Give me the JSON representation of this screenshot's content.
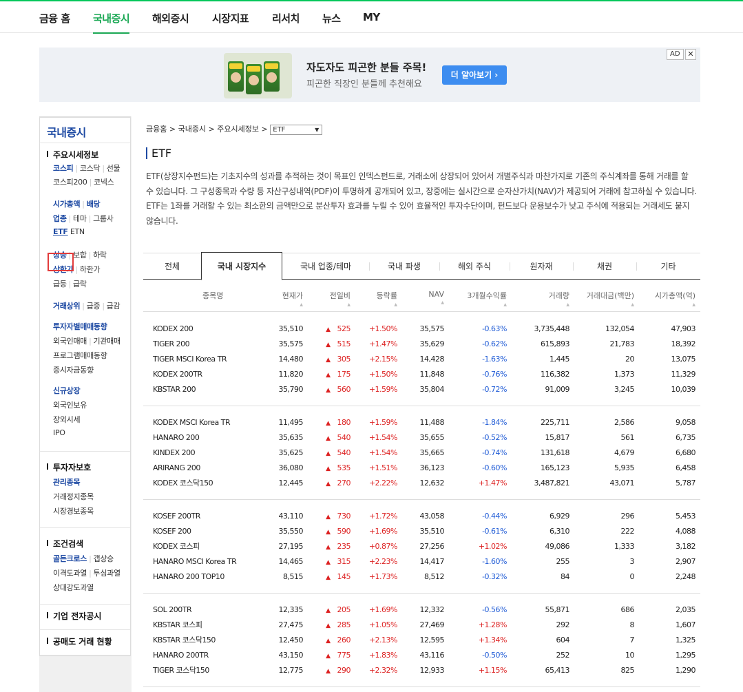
{
  "gnb": {
    "items": [
      "금융 홈",
      "국내증시",
      "해외증시",
      "시장지표",
      "리서치",
      "뉴스",
      "MY"
    ],
    "active_index": 1
  },
  "ad": {
    "title": "자도자도 피곤한 분들 주목!",
    "subtitle": "피곤한 직장인 분들께 추천해요",
    "button": "더 알아보기 ›",
    "mark": "AD",
    "close": "✕"
  },
  "lnb": {
    "title": "국내증시",
    "sections": [
      {
        "heading": "주요시세정보",
        "rows": [
          [
            {
              "t": "코스피",
              "b": true
            },
            {
              "t": "코스닥"
            },
            {
              "t": "선물"
            }
          ],
          [
            {
              "t": "코스피200"
            },
            {
              "t": "코넥스"
            }
          ],
          [
            {
              "t": "시가총액",
              "b": true
            },
            {
              "t": "배당",
              "b": true
            }
          ],
          [
            {
              "t": "업종",
              "b": true
            },
            {
              "t": "테마"
            },
            {
              "t": "그룹사"
            }
          ],
          [
            {
              "t": "ETF",
              "b": true,
              "u": true
            },
            {
              "t": "ETN",
              "nosep": true
            }
          ],
          [
            {
              "t": "상승",
              "b": true
            },
            {
              "t": "보합"
            },
            {
              "t": "하락"
            }
          ],
          [
            {
              "t": "상한가",
              "b": true
            },
            {
              "t": "하한가"
            }
          ],
          [
            {
              "t": "급등"
            },
            {
              "t": "급락"
            }
          ],
          [
            {
              "t": "거래상위",
              "b": true
            },
            {
              "t": "급증"
            },
            {
              "t": "급감"
            }
          ],
          [
            {
              "t": "투자자별매매동향",
              "b": true
            }
          ],
          [
            {
              "t": "외국인매매"
            },
            {
              "t": "기관매매"
            }
          ],
          [
            {
              "t": "프로그램매매동향"
            }
          ],
          [
            {
              "t": "증시자금동향"
            }
          ],
          [
            {
              "t": "신규상장",
              "b": true
            }
          ],
          [
            {
              "t": "외국인보유"
            }
          ],
          [
            {
              "t": "장외시세"
            }
          ],
          [
            {
              "t": "IPO"
            }
          ]
        ]
      },
      {
        "heading": "투자자보호",
        "rows": [
          [
            {
              "t": "관리종목",
              "b": true
            }
          ],
          [
            {
              "t": "거래정지종목"
            }
          ],
          [
            {
              "t": "시장경보종목"
            }
          ]
        ]
      },
      {
        "heading": "조건검색",
        "rows": [
          [
            {
              "t": "골든크로스",
              "b": true
            },
            {
              "t": "갭상승"
            }
          ],
          [
            {
              "t": "이격도과열"
            },
            {
              "t": "투심과열"
            }
          ],
          [
            {
              "t": "상대강도과열"
            }
          ]
        ]
      },
      {
        "heading": "기업 전자공시",
        "rows": []
      },
      {
        "heading": "공매도 거래 현황",
        "rows": []
      }
    ]
  },
  "breadcrumb": {
    "items": [
      "금융홈",
      "국내증시",
      "주요시세정보"
    ],
    "separator": ">",
    "select_value": "ETF"
  },
  "page": {
    "title": "ETF",
    "description": "ETF(상장지수펀드)는 기초지수의 성과를 추적하는 것이 목표인 인덱스펀드로, 거래소에 상장되어 있어서 개별주식과 마찬가지로 기존의 주식계좌를 통해 거래를 할 수 있습니다. 그 구성종목과 수량 등 자산구성내역(PDF)이 투명하게 공개되어 있고, 장중에는 실시간으로 순자산가치(NAV)가 제공되어 거래에 참고하실 수 있습니다. ETF는 1좌를 거래할 수 있는 최소한의 금액만으로 분산투자 효과를 누릴 수 있어 효율적인 투자수단이며, 펀드보다 운용보수가 낮고 주식에 적용되는 거래세도 붙지 않습니다."
  },
  "tabs": {
    "items": [
      "전체",
      "국내 시장지수",
      "국내 업종/테마",
      "국내 파생",
      "해외 주식",
      "원자재",
      "채권",
      "기타"
    ],
    "active_index": 1
  },
  "table": {
    "headers": [
      "종목명",
      "현재가",
      "전일비",
      "등락률",
      "NAV",
      "3개월수익률",
      "거래량",
      "거래대금(백만)",
      "시가총액(억)"
    ],
    "sort_glyph": "▲",
    "up_glyph": "▲",
    "groups": [
      [
        [
          "KODEX 200",
          "35,510",
          "525",
          "+1.50%",
          "35,575",
          "-0.63%",
          "3,735,448",
          "132,054",
          "47,903"
        ],
        [
          "TIGER 200",
          "35,575",
          "515",
          "+1.47%",
          "35,629",
          "-0.62%",
          "615,893",
          "21,783",
          "18,392"
        ],
        [
          "TIGER MSCI Korea TR",
          "14,480",
          "305",
          "+2.15%",
          "14,428",
          "-1.63%",
          "1,445",
          "20",
          "13,075"
        ],
        [
          "KODEX 200TR",
          "11,820",
          "175",
          "+1.50%",
          "11,848",
          "-0.76%",
          "116,382",
          "1,373",
          "11,329"
        ],
        [
          "KBSTAR 200",
          "35,790",
          "560",
          "+1.59%",
          "35,804",
          "-0.72%",
          "91,009",
          "3,245",
          "10,039"
        ]
      ],
      [
        [
          "KODEX MSCI Korea TR",
          "11,495",
          "180",
          "+1.59%",
          "11,488",
          "-1.84%",
          "225,711",
          "2,586",
          "9,058"
        ],
        [
          "HANARO 200",
          "35,635",
          "540",
          "+1.54%",
          "35,655",
          "-0.52%",
          "15,817",
          "561",
          "6,735"
        ],
        [
          "KINDEX 200",
          "35,625",
          "540",
          "+1.54%",
          "35,665",
          "-0.74%",
          "131,618",
          "4,679",
          "6,680"
        ],
        [
          "ARIRANG 200",
          "36,080",
          "535",
          "+1.51%",
          "36,123",
          "-0.60%",
          "165,123",
          "5,935",
          "6,458"
        ],
        [
          "KODEX 코스닥150",
          "12,445",
          "270",
          "+2.22%",
          "12,632",
          "+1.47%",
          "3,487,821",
          "43,071",
          "5,787"
        ]
      ],
      [
        [
          "KOSEF 200TR",
          "43,110",
          "730",
          "+1.72%",
          "43,058",
          "-0.44%",
          "6,929",
          "296",
          "5,453"
        ],
        [
          "KOSEF 200",
          "35,550",
          "590",
          "+1.69%",
          "35,510",
          "-0.61%",
          "6,310",
          "222",
          "4,088"
        ],
        [
          "KODEX 코스피",
          "27,195",
          "235",
          "+0.87%",
          "27,256",
          "+1.02%",
          "49,086",
          "1,333",
          "3,182"
        ],
        [
          "HANARO MSCI Korea TR",
          "14,465",
          "315",
          "+2.23%",
          "14,417",
          "-1.60%",
          "255",
          "3",
          "2,907"
        ],
        [
          "HANARO 200 TOP10",
          "8,515",
          "145",
          "+1.73%",
          "8,512",
          "-0.32%",
          "84",
          "0",
          "2,248"
        ]
      ],
      [
        [
          "SOL 200TR",
          "12,335",
          "205",
          "+1.69%",
          "12,332",
          "-0.56%",
          "55,871",
          "686",
          "2,035"
        ],
        [
          "KBSTAR 코스피",
          "27,475",
          "285",
          "+1.05%",
          "27,469",
          "+1.28%",
          "292",
          "8",
          "1,607"
        ],
        [
          "KBSTAR 코스닥150",
          "12,450",
          "260",
          "+2.13%",
          "12,595",
          "+1.34%",
          "604",
          "7",
          "1,325"
        ],
        [
          "HANARO 200TR",
          "43,150",
          "775",
          "+1.83%",
          "43,116",
          "-0.50%",
          "252",
          "10",
          "1,295"
        ],
        [
          "TIGER 코스닥150",
          "12,775",
          "290",
          "+2.32%",
          "12,933",
          "+1.15%",
          "65,413",
          "825",
          "1,290"
        ]
      ]
    ]
  }
}
